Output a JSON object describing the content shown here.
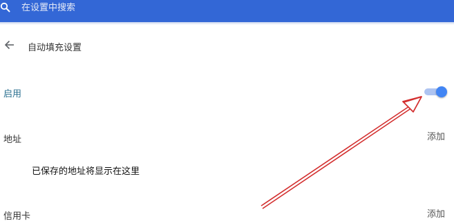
{
  "search": {
    "placeholder": "在设置中搜索",
    "icon": "search-icon"
  },
  "header": {
    "title": "自动填充设置",
    "back_icon": "arrow-back-icon"
  },
  "enable": {
    "label": "启用",
    "toggle_on": true,
    "accent_color": "#4285f4"
  },
  "addresses": {
    "label": "地址",
    "add_label": "添加",
    "empty_text": "已保存的地址将显示在这里"
  },
  "credit_cards": {
    "label": "信用卡",
    "add_label": "添加"
  },
  "colors": {
    "top_bar": "#3367d6",
    "annotation_arrow": "#d32f2f"
  }
}
